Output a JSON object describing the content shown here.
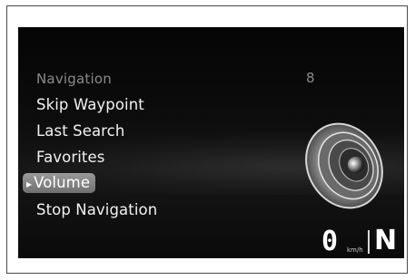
{
  "header": {
    "title": "Navigation",
    "count": "8"
  },
  "menu": {
    "items": [
      {
        "label": "Skip Waypoint"
      },
      {
        "label": "Last Search"
      },
      {
        "label": "Favorites"
      },
      {
        "label": "Volume",
        "selected": true
      },
      {
        "label": "Stop Navigation"
      }
    ]
  },
  "status": {
    "speed": "0",
    "speed_unit": "km/h",
    "gear": "N"
  },
  "icons": {
    "selector": "diamond-arrow-icon",
    "speaker": "speaker-icon"
  },
  "colors": {
    "background": "#0a0a0a",
    "highlight": "#8a8a8a",
    "text": "#f2f2f2",
    "dim_text": "#8a8a8a"
  }
}
